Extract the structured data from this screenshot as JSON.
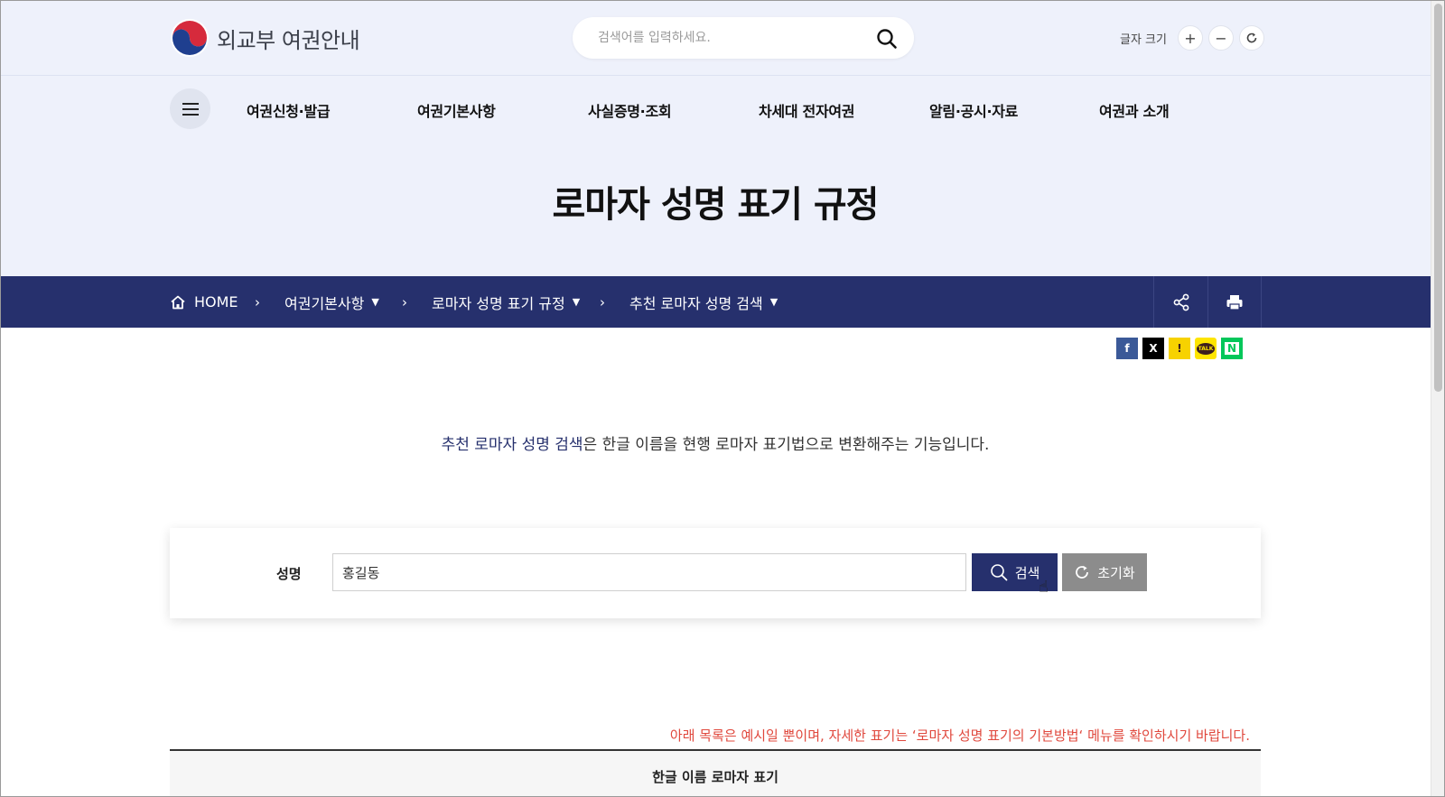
{
  "header": {
    "logo_text": "외교부 여권안내",
    "search_placeholder": "검색어를 입력하세요.",
    "font_size_label": "글자 크기",
    "font_plus": "+",
    "font_minus": "−"
  },
  "gnb": {
    "items": [
      "여권신청·발급",
      "여권기본사항",
      "사실증명·조회",
      "차세대 전자여권",
      "알림·공시·자료",
      "여권과 소개"
    ]
  },
  "page_title": "로마자 성명 표기 규정",
  "breadcrumb": {
    "home": "HOME",
    "level1": "여권기본사항",
    "level2": "로마자 성명 표기 규정",
    "level3": "추천 로마자 성명 검색"
  },
  "sns": {
    "facebook": "f",
    "x": "X",
    "kakaostory": "!",
    "kakaotalk": "TALK",
    "naver": "N"
  },
  "intro": {
    "highlight": "추천 로마자 성명 검색",
    "rest": "은 한글 이름을 현행 로마자 표기법으로 변환해주는 기능입니다."
  },
  "form": {
    "label": "성명",
    "value": "홍길동",
    "search_button": "검색",
    "reset_button": "초기화"
  },
  "notice": "아래 목록은 예시일 뿐이며, 자세한 표기는 ‘로마자 성명 표기의 기본방법‘ 메뉴를 확인하시기 바랍니다.",
  "table": {
    "header": "한글 이름 로마자 표기"
  },
  "colors": {
    "navy": "#26306d",
    "header_bg": "#eef1fb",
    "notice_red": "#e0483d",
    "reset_gray": "#8c8c8c"
  }
}
